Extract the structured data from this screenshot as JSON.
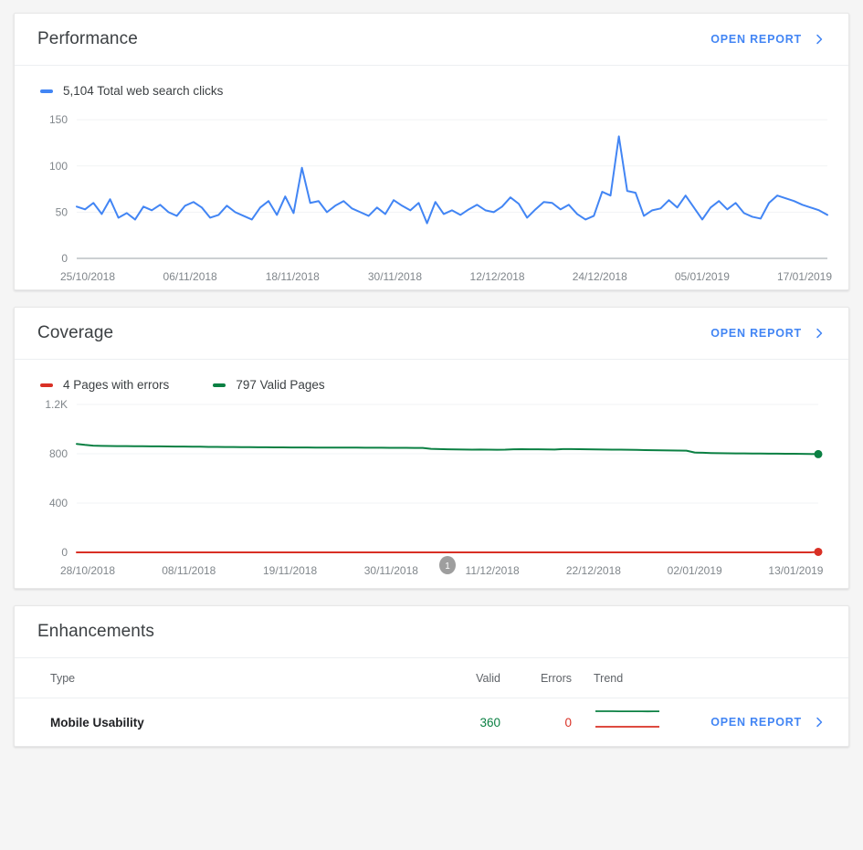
{
  "theme": {
    "page_bg": "#f5f5f5",
    "card_bg": "#ffffff",
    "accent_blue": "#4285f4",
    "clicks_line": "#4285f4",
    "error_red": "#d93025",
    "valid_green": "#0b8043",
    "text_primary": "#3c4043",
    "text_muted": "#80868b"
  },
  "performance": {
    "title": "Performance",
    "open_report_label": "OPEN REPORT",
    "chevron_icon": "chevron-right-icon",
    "legend": [
      {
        "label": "5,104 Total web search clicks",
        "color": "#4285f4",
        "icon": "line-swatch-icon"
      }
    ]
  },
  "coverage": {
    "title": "Coverage",
    "open_report_label": "OPEN REPORT",
    "chevron_icon": "chevron-right-icon",
    "legend": [
      {
        "label": "4 Pages with errors",
        "color": "#d93025",
        "icon": "line-swatch-icon"
      },
      {
        "label": "797 Valid Pages",
        "color": "#0b8043",
        "icon": "line-swatch-icon"
      }
    ],
    "annotation_badge": "1"
  },
  "enhancements": {
    "title": "Enhancements",
    "columns": {
      "type": "Type",
      "valid": "Valid",
      "errors": "Errors",
      "trend": "Trend"
    },
    "rows": [
      {
        "type": "Mobile Usability",
        "valid": "360",
        "errors": "0",
        "open_report_label": "OPEN REPORT",
        "chevron_icon": "chevron-right-icon"
      }
    ]
  },
  "chart_data": [
    {
      "id": "performance-clicks",
      "type": "line",
      "title": "Performance",
      "series": [
        {
          "name": "Total web search clicks",
          "color": "#4285f4",
          "total": 5104,
          "values": [
            56,
            53,
            60,
            48,
            64,
            44,
            49,
            42,
            56,
            52,
            58,
            50,
            46,
            57,
            61,
            55,
            44,
            47,
            57,
            50,
            46,
            42,
            55,
            62,
            47,
            67,
            49,
            98,
            60,
            62,
            50,
            57,
            62,
            54,
            50,
            46,
            55,
            48,
            63,
            57,
            52,
            60,
            38,
            61,
            48,
            52,
            47,
            53,
            58,
            52,
            50,
            56,
            66,
            59,
            44,
            53,
            61,
            60,
            53,
            58,
            48,
            42,
            46,
            72,
            68,
            132,
            73,
            71,
            46,
            52,
            54,
            63,
            55,
            68,
            55,
            42,
            55,
            62,
            53,
            60,
            49,
            45,
            43,
            60,
            68,
            65,
            62,
            58,
            55,
            52,
            47
          ]
        }
      ],
      "xlabel": "",
      "ylabel": "",
      "ylim": [
        0,
        160
      ],
      "yticks": [
        0,
        50,
        100,
        150
      ],
      "ytick_labels": [
        "0",
        "50",
        "100",
        "150"
      ],
      "xtick_labels": [
        "25/10/2018",
        "06/11/2018",
        "18/11/2018",
        "30/11/2018",
        "12/12/2018",
        "24/12/2018",
        "05/01/2019",
        "17/01/2019"
      ],
      "grid": true,
      "legend_position": "top-left"
    },
    {
      "id": "coverage-pages",
      "type": "line",
      "title": "Coverage",
      "series": [
        {
          "name": "Valid Pages",
          "color": "#0b8043",
          "total": 797,
          "values": [
            880,
            872,
            866,
            864,
            863,
            862,
            862,
            861,
            861,
            860,
            860,
            859,
            858,
            858,
            857,
            857,
            856,
            856,
            855,
            855,
            854,
            854,
            853,
            853,
            852,
            852,
            851,
            851,
            851,
            850,
            850,
            850,
            850,
            850,
            850,
            849,
            849,
            849,
            848,
            848,
            848,
            847,
            847,
            840,
            838,
            836,
            835,
            834,
            833,
            834,
            833,
            832,
            833,
            836,
            837,
            836,
            836,
            835,
            834,
            838,
            838,
            837,
            836,
            835,
            834,
            833,
            833,
            832,
            831,
            830,
            829,
            828,
            827,
            826,
            825,
            810,
            808,
            806,
            805,
            804,
            803,
            803,
            802,
            802,
            801,
            801,
            800,
            800,
            799,
            798,
            797
          ]
        },
        {
          "name": "Pages with errors",
          "color": "#d93025",
          "total": 4,
          "values": [
            0,
            0,
            0,
            0,
            0,
            0,
            0,
            0,
            0,
            0,
            0,
            0,
            0,
            0,
            0,
            0,
            0,
            0,
            0,
            0,
            0,
            0,
            0,
            0,
            0,
            0,
            0,
            0,
            0,
            0,
            0,
            0,
            0,
            0,
            0,
            0,
            0,
            0,
            0,
            0,
            0,
            0,
            0,
            0,
            0,
            0,
            0,
            0,
            0,
            0,
            0,
            0,
            0,
            0,
            0,
            0,
            0,
            0,
            0,
            0,
            0,
            0,
            0,
            0,
            0,
            0,
            0,
            0,
            0,
            0,
            0,
            0,
            0,
            0,
            0,
            0,
            0,
            0,
            0,
            0,
            0,
            0,
            0,
            0,
            0,
            0,
            0,
            0,
            0,
            0,
            4
          ]
        }
      ],
      "xlabel": "",
      "ylabel": "",
      "ylim": [
        0,
        1200
      ],
      "yticks": [
        0,
        400,
        800,
        1200
      ],
      "ytick_labels": [
        "0",
        "400",
        "800",
        "1.2K"
      ],
      "xtick_labels": [
        "28/10/2018",
        "08/11/2018",
        "19/11/2018",
        "30/11/2018",
        "11/12/2018",
        "22/12/2018",
        "02/01/2019",
        "13/01/2019"
      ],
      "grid": true,
      "legend_position": "top-left",
      "annotations": [
        {
          "label": "1",
          "x_index": 45
        }
      ]
    },
    {
      "id": "mobile-usability-trend",
      "type": "line",
      "title": "Trend",
      "series": [
        {
          "name": "Valid",
          "color": "#0b8043",
          "values": [
            362,
            362,
            361,
            361,
            360,
            359,
            358,
            357,
            358,
            356,
            357,
            360
          ]
        },
        {
          "name": "Errors",
          "color": "#d93025",
          "values": [
            0,
            0,
            0,
            0,
            0,
            0,
            0,
            0,
            0,
            0,
            0,
            0
          ]
        }
      ],
      "grid": false,
      "ylim": [
        0,
        400
      ]
    }
  ]
}
